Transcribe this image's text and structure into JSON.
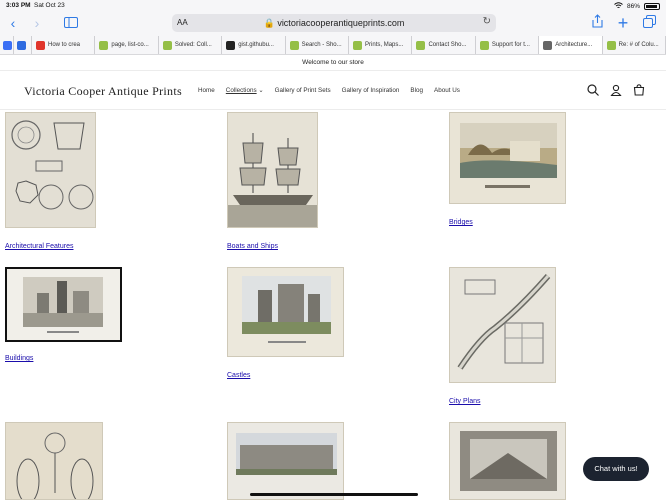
{
  "status": {
    "time": "3:03 PM",
    "date": "Sat Oct 23",
    "battery": "86%"
  },
  "browser": {
    "address_prefix": "AA",
    "url": "victoriacooperantiqueprints.com",
    "tabs": [
      {
        "label": "",
        "color": "#3b6ff5"
      },
      {
        "label": "",
        "color": "#2f6be0"
      },
      {
        "label": "How to crea",
        "color": "#e0352b"
      },
      {
        "label": "page, list-co...",
        "color": "#95bf47"
      },
      {
        "label": "Solved: Coll...",
        "color": "#95bf47"
      },
      {
        "label": "gist.githubu...",
        "color": "#222222"
      },
      {
        "label": "Search - Sho...",
        "color": "#95bf47"
      },
      {
        "label": "Prints, Maps...",
        "color": "#95bf47"
      },
      {
        "label": "Contact Sho...",
        "color": "#95bf47"
      },
      {
        "label": "Support for t...",
        "color": "#95bf47"
      },
      {
        "label": "Architecture...",
        "color": "#666666"
      },
      {
        "label": "Re: # of Colu...",
        "color": "#95bf47"
      }
    ]
  },
  "site": {
    "announcement": "Welcome to our store",
    "logo": "Victoria Cooper Antique Prints",
    "nav": [
      "Home",
      "Collections",
      "Gallery of Print Sets",
      "Gallery of Inspiration",
      "Blog",
      "About Us"
    ]
  },
  "collections": [
    {
      "title": "Architectural Features"
    },
    {
      "title": "Boats and Ships"
    },
    {
      "title": "Bridges"
    },
    {
      "title": "Buildings"
    },
    {
      "title": "Castles"
    },
    {
      "title": "City Plans"
    },
    {
      "title": ""
    },
    {
      "title": ""
    },
    {
      "title": ""
    }
  ],
  "chat": {
    "label": "Chat with us!"
  },
  "colors": {
    "link": "#1a0dab",
    "accent": "#2f7ae5",
    "chat_bg": "#1c2330"
  }
}
